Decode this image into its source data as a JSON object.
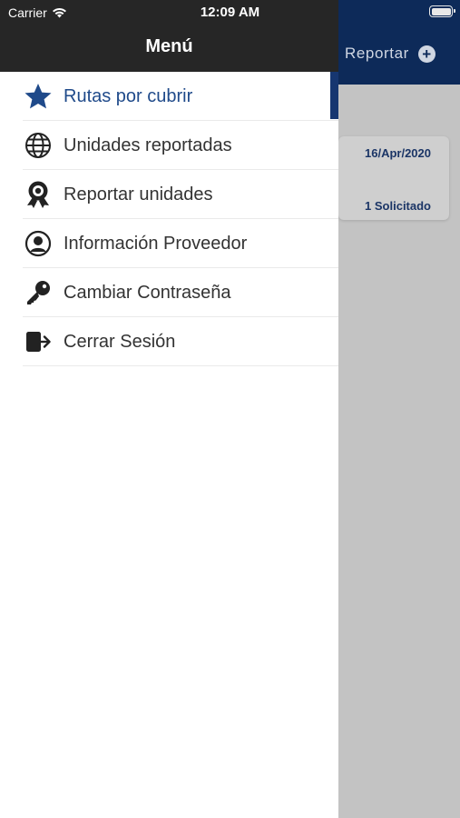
{
  "status_bar": {
    "carrier": "Carrier",
    "time": "12:09 AM"
  },
  "drawer": {
    "title": "Menú"
  },
  "menu": {
    "items": [
      {
        "label": "Rutas por cubrir",
        "icon": "star-icon",
        "active": true
      },
      {
        "label": "Unidades reportadas",
        "icon": "globe-icon",
        "active": false
      },
      {
        "label": "Reportar unidades",
        "icon": "award-icon",
        "active": false
      },
      {
        "label": "Información Proveedor",
        "icon": "user-circle-icon",
        "active": false
      },
      {
        "label": "Cambiar Contraseña",
        "icon": "key-icon",
        "active": false
      },
      {
        "label": "Cerrar Sesión",
        "icon": "logout-icon",
        "active": false
      }
    ]
  },
  "background": {
    "header_action": "Reportar",
    "card": {
      "date": "16/Apr/2020",
      "status": "1 Solicitado"
    }
  },
  "colors": {
    "drawer_header": "#262626",
    "accent": "#1f4a8a",
    "app_header": "#0d2a59",
    "overlay": "#c3c3c3"
  }
}
